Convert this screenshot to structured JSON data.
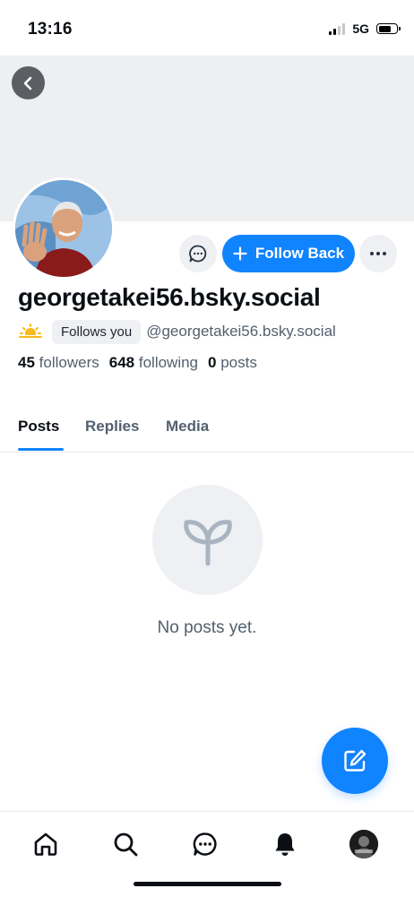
{
  "status_bar": {
    "time": "13:16",
    "network": "5G",
    "battery_level": 0.7
  },
  "profile": {
    "display_name": "georgetakei56.bsky.social",
    "handle": "@georgetakei56.bsky.social",
    "follows_you_badge": "Follows you",
    "emoji": "sun-behind-cloud-icon"
  },
  "actions": {
    "follow_label": "Follow Back"
  },
  "stats": {
    "followers_count": "45",
    "followers_label": "followers",
    "following_count": "648",
    "following_label": "following",
    "posts_count": "0",
    "posts_label": "posts"
  },
  "tabs": [
    {
      "label": "Posts",
      "active": true
    },
    {
      "label": "Replies",
      "active": false
    },
    {
      "label": "Media",
      "active": false
    }
  ],
  "empty_state": {
    "text": "No posts yet.",
    "icon": "sprout-icon"
  },
  "bottom_nav": [
    "home-icon",
    "search-icon",
    "chat-icon",
    "bell-icon",
    "avatar"
  ],
  "colors": {
    "accent": "#1083fe",
    "banner": "#eeeff1",
    "muted_text": "#52606f"
  }
}
